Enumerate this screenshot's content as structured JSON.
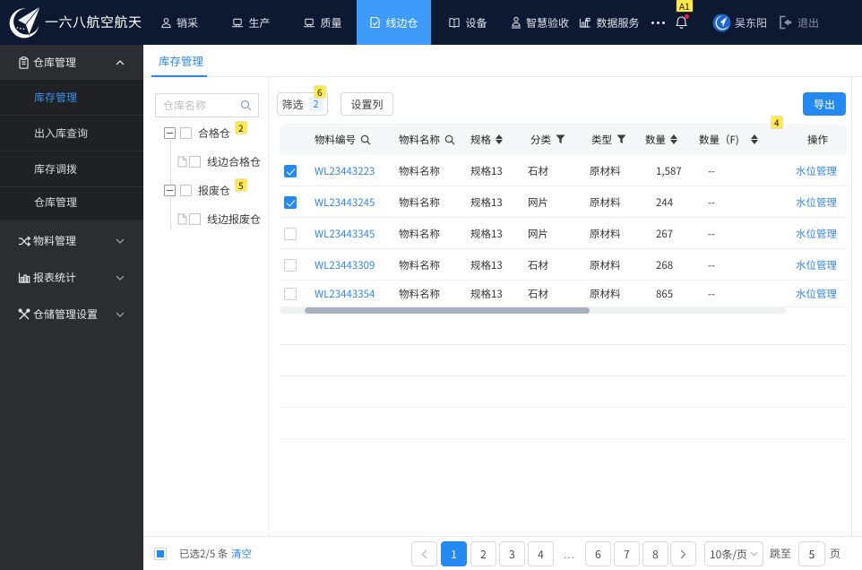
{
  "header": {
    "brand": "一六八航空航天",
    "nav": [
      {
        "label": "销采"
      },
      {
        "label": "生产"
      },
      {
        "label": "质量"
      },
      {
        "label": "线边仓"
      },
      {
        "label": "设备"
      },
      {
        "label": "智慧验收"
      },
      {
        "label": "数据服务"
      }
    ],
    "user_name": "吴东阳",
    "logout_label": "退出"
  },
  "sidebar": {
    "groups": [
      {
        "label": "仓库管理",
        "expanded": true
      },
      {
        "label": "物料管理",
        "expanded": false
      },
      {
        "label": "报表统计",
        "expanded": false
      },
      {
        "label": "仓储管理设置",
        "expanded": false
      }
    ],
    "sub_items": [
      {
        "label": "库存管理",
        "active": true
      },
      {
        "label": "出入库查询",
        "active": false
      },
      {
        "label": "库存调拨",
        "active": false
      },
      {
        "label": "仓库管理",
        "active": false
      }
    ]
  },
  "tab": {
    "label": "库存管理"
  },
  "tree_panel": {
    "search_placeholder": "仓库名称",
    "nodes": [
      {
        "label": "合格仓"
      },
      {
        "label": "线边合格仓"
      },
      {
        "label": "报废仓"
      },
      {
        "label": "线边报废仓"
      }
    ]
  },
  "toolbar": {
    "filter_label": "筛选",
    "filter_count": "2",
    "columns_label": "设置列",
    "export_label": "导出"
  },
  "table": {
    "columns": {
      "code": "物料编号",
      "name": "物料名称",
      "spec": "规格",
      "category": "分类",
      "type": "类型",
      "qty": "数量",
      "qty_f": "数量（F)",
      "action": "操作"
    },
    "action_label": "水位管理",
    "rows": [
      {
        "code": "WL23443223",
        "name": "物料名称",
        "spec": "规格13",
        "category": "石材",
        "type": "原材料",
        "qty": "1,587",
        "qty_f": "--"
      },
      {
        "code": "WL23443245",
        "name": "物料名称",
        "spec": "规格13",
        "category": "网片",
        "type": "原材料",
        "qty": "244",
        "qty_f": "--"
      },
      {
        "code": "WL23443345",
        "name": "物料名称",
        "spec": "规格13",
        "category": "网片",
        "type": "原材料",
        "qty": "267",
        "qty_f": "--"
      },
      {
        "code": "WL23443309",
        "name": "物料名称",
        "spec": "规格13",
        "category": "石材",
        "type": "原材料",
        "qty": "268",
        "qty_f": "--"
      },
      {
        "code": "WL23443354",
        "name": "物料名称",
        "spec": "规格13",
        "category": "石材",
        "type": "原材料",
        "qty": "865",
        "qty_f": "--"
      }
    ]
  },
  "footer": {
    "selected_text": "已选2/5 条",
    "clear_label": "清空",
    "pages": [
      "1",
      "2",
      "3",
      "4",
      "...",
      "6",
      "7",
      "8"
    ],
    "active_page": "1",
    "page_size_label": "10条/页",
    "jump_prefix": "跳至",
    "jump_value": "5",
    "jump_suffix": "页"
  },
  "annotations": {
    "bell": "A1",
    "filter": "6",
    "tree_top": "2",
    "tree_bottom": "5",
    "qty_f": "4"
  },
  "colors": {
    "topbar_bg": "#0d1930",
    "nav_active_bg": "#3e9bfa",
    "accent_blue": "#2589f2",
    "link_blue": "#3484e4",
    "annotation_yellow": "#ffe94d"
  }
}
